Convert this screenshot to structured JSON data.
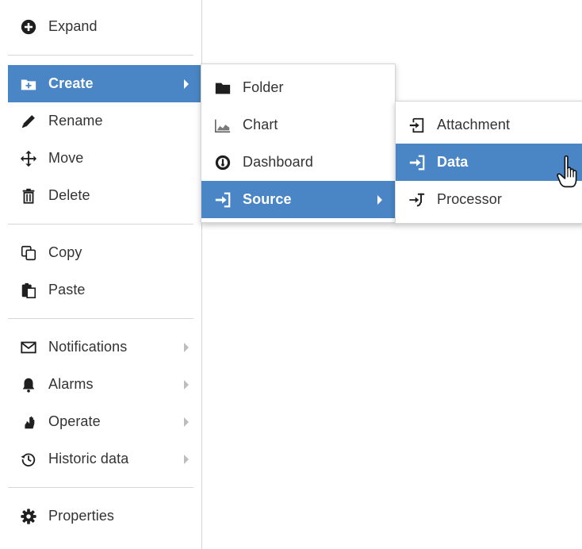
{
  "main_menu": {
    "groups": [
      [
        {
          "label": "Expand",
          "icon": "plus-circle-icon",
          "has_submenu": false
        }
      ],
      [
        {
          "label": "Create",
          "icon": "folder-plus-icon",
          "has_submenu": true,
          "active": true
        },
        {
          "label": "Rename",
          "icon": "pencil-icon",
          "has_submenu": false
        },
        {
          "label": "Move",
          "icon": "move-arrows-icon",
          "has_submenu": false
        },
        {
          "label": "Delete",
          "icon": "trash-icon",
          "has_submenu": false
        }
      ],
      [
        {
          "label": "Copy",
          "icon": "copy-icon",
          "has_submenu": false
        },
        {
          "label": "Paste",
          "icon": "paste-icon",
          "has_submenu": false
        }
      ],
      [
        {
          "label": "Notifications",
          "icon": "envelope-icon",
          "has_submenu": true
        },
        {
          "label": "Alarms",
          "icon": "bell-icon",
          "has_submenu": true
        },
        {
          "label": "Operate",
          "icon": "hand-icon",
          "has_submenu": true
        },
        {
          "label": "Historic data",
          "icon": "history-icon",
          "has_submenu": true
        }
      ],
      [
        {
          "label": "Properties",
          "icon": "gear-icon",
          "has_submenu": false
        }
      ]
    ]
  },
  "create_menu": {
    "items": [
      {
        "label": "Folder",
        "icon": "folder-icon",
        "has_submenu": false
      },
      {
        "label": "Chart",
        "icon": "area-chart-icon",
        "has_submenu": false
      },
      {
        "label": "Dashboard",
        "icon": "dashboard-gauge-icon",
        "has_submenu": false
      },
      {
        "label": "Source",
        "icon": "sign-in-icon",
        "has_submenu": true,
        "active": true
      }
    ]
  },
  "source_menu": {
    "items": [
      {
        "label": "Attachment",
        "icon": "attachment-icon",
        "has_submenu": false
      },
      {
        "label": "Data",
        "icon": "sign-in-icon",
        "has_submenu": false,
        "active": true
      },
      {
        "label": "Processor",
        "icon": "processor-icon",
        "has_submenu": false
      }
    ]
  },
  "colors": {
    "accent": "#4a86c5",
    "text": "#333333",
    "icon": "#1f1f1f",
    "separator": "#d6d6d6",
    "arrow": "#bdbdbd"
  }
}
